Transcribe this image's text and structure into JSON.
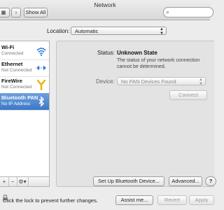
{
  "window": {
    "title": "Network"
  },
  "toolbar": {
    "show_all": "Show All",
    "search_placeholder": ""
  },
  "location": {
    "label": "Location:",
    "value": "Automatic"
  },
  "services": [
    {
      "name": "Wi-Fi",
      "status": "Connected",
      "icon": "wifi-icon"
    },
    {
      "name": "Ethernet",
      "status": "Not Connected",
      "icon": "ethernet-icon"
    },
    {
      "name": "FireWire",
      "status": "Not Connected",
      "icon": "firewire-icon"
    },
    {
      "name": "Bluetooth PAN",
      "status": "No IP Address",
      "icon": "bluetooth-icon",
      "selected": true
    }
  ],
  "sidebar_footer": {
    "add": "+",
    "remove": "−",
    "gear": "⚙▾"
  },
  "detail": {
    "status_label": "Status:",
    "status_value": "Unknown State",
    "status_desc_line1": "The status of your network connection",
    "status_desc_line2": "cannot be determined.",
    "device_label": "Device:",
    "device_value": "No PAN Devices Found",
    "connect": "Connect",
    "setup_bluetooth": "Set Up Bluetooth Device...",
    "advanced": "Advanced...",
    "help": "?"
  },
  "footer": {
    "lock_text": "Click the lock to prevent further changes.",
    "assist": "Assist me...",
    "revert": "Revert",
    "apply": "Apply"
  },
  "colors": {
    "selection": "#3d78c8",
    "wifi": "#2f80d8",
    "ethernet": "#3a7bd5",
    "firewire": "#e8b400"
  }
}
